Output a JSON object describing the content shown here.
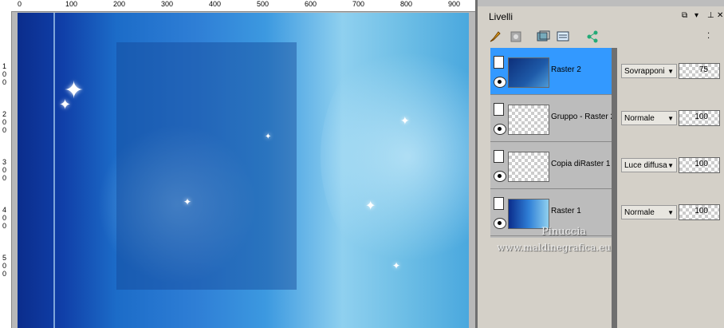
{
  "ruler": {
    "top_labels": [
      "0",
      "100",
      "200",
      "300",
      "400",
      "500",
      "600",
      "700",
      "800",
      "900"
    ],
    "left_labels": [
      "1 0 0",
      "2 0 0",
      "3 0 0",
      "4 0 0",
      "5 0 0"
    ]
  },
  "panel": {
    "title": "Livelli",
    "layers": [
      {
        "name": "Raster 2",
        "blend": "Sovrapponi",
        "opacity": "75",
        "active": true
      },
      {
        "name": "Gruppo - Raster 2",
        "blend": "Normale",
        "opacity": "100",
        "active": false
      },
      {
        "name": "Copia diRaster 1",
        "blend": "Luce diffusa",
        "opacity": "100",
        "active": false
      },
      {
        "name": "Raster 1",
        "blend": "Normale",
        "opacity": "100",
        "active": false
      }
    ]
  },
  "watermark": {
    "line1": "Pinuccia",
    "line2": "www.maldinegrafica.eu"
  },
  "icons": {
    "toolbar": [
      "brush-icon",
      "mask-icon",
      "new-layer-icon",
      "layer-properties-icon",
      "share-icon"
    ],
    "header": [
      "dock-icon",
      "pin-icon",
      "close-icon",
      "more-icon"
    ]
  }
}
